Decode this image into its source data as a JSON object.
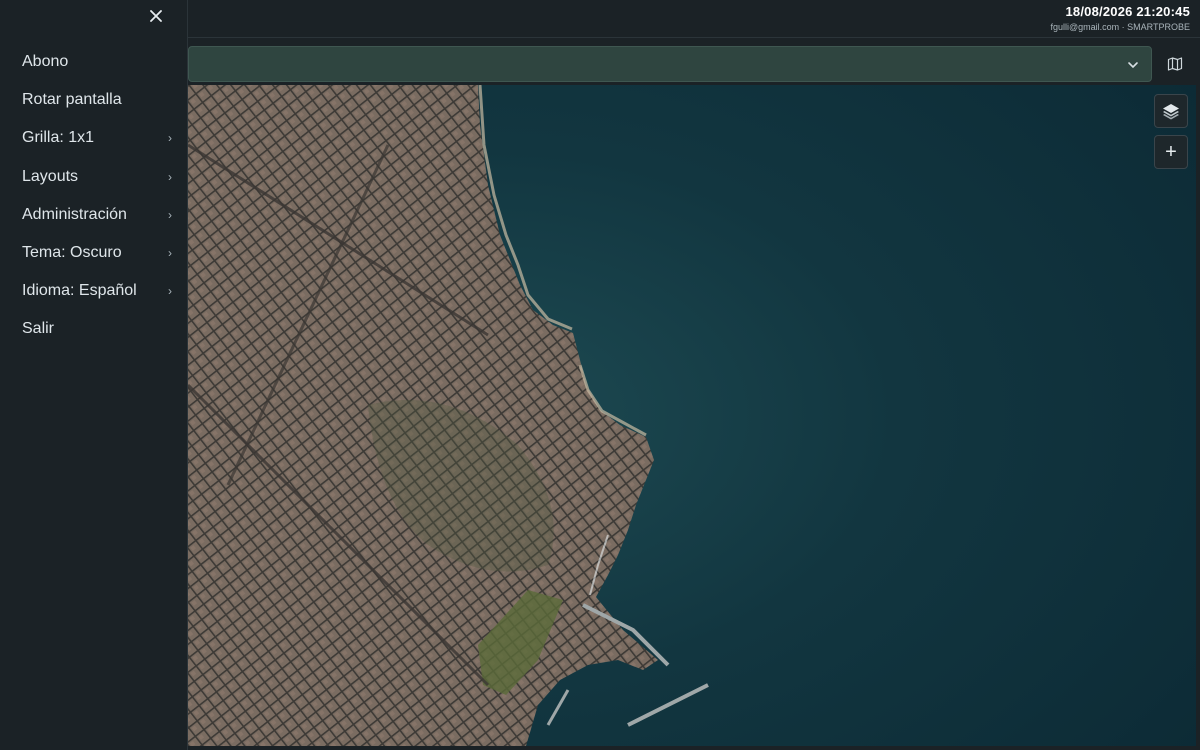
{
  "header": {
    "datetime": "18/08/2026 21:20:45",
    "user_line": "fgulli@gmail.com · SMARTPROBE"
  },
  "menu": {
    "close_icon": "close-icon",
    "items": [
      {
        "label": "Abono",
        "submenu": false
      },
      {
        "label": "Rotar pantalla",
        "submenu": false
      },
      {
        "label": "Grilla: 1x1",
        "submenu": true
      },
      {
        "label": "Layouts",
        "submenu": true
      },
      {
        "label": "Administración",
        "submenu": true
      },
      {
        "label": "Tema: Oscuro",
        "submenu": true
      },
      {
        "label": "Idioma: Español",
        "submenu": true
      },
      {
        "label": "Salir",
        "submenu": false
      }
    ],
    "submenu_glyph": "›"
  },
  "selector": {
    "value": "",
    "chevron_icon": "chevron-down-icon",
    "map_toggle_icon": "map-icon"
  },
  "map": {
    "view": "satellite",
    "controls": [
      {
        "icon": "layers-icon"
      },
      {
        "icon": "zoom-in-icon",
        "glyph": "+"
      }
    ]
  },
  "colors": {
    "background": "#1b2226",
    "selector_fill": "#2f4540",
    "sea": "#0f2c36",
    "land": "#6f6157"
  }
}
